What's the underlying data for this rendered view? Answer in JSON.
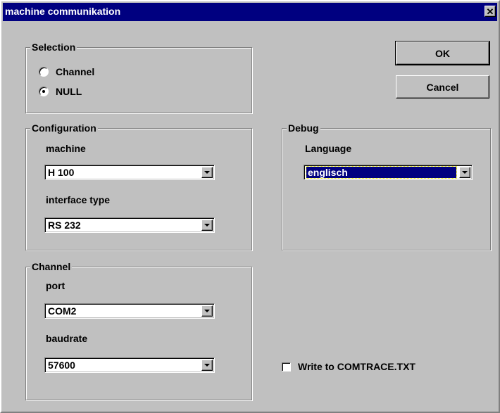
{
  "window": {
    "title": "machine communikation",
    "close_glyph": "✕"
  },
  "selection": {
    "legend": "Selection",
    "options": [
      {
        "label": "Channel",
        "checked": false
      },
      {
        "label": "NULL",
        "checked": true
      }
    ]
  },
  "configuration": {
    "legend": "Configuration",
    "machine_label": "machine",
    "machine_value": "H 100",
    "interface_label": "interface type",
    "interface_value": "RS 232"
  },
  "channel": {
    "legend": "Channel",
    "port_label": "port",
    "port_value": "COM2",
    "baudrate_label": "baudrate",
    "baudrate_value": "57600"
  },
  "debug": {
    "legend": "Debug",
    "language_label": "Language",
    "language_value": "englisch"
  },
  "buttons": {
    "ok": "OK",
    "cancel": "Cancel"
  },
  "trace": {
    "label": "Write to COMTRACE.TXT",
    "checked": false
  },
  "colors": {
    "face": "#c0c0c0",
    "titlebar": "#000080",
    "selection": "#000080"
  }
}
